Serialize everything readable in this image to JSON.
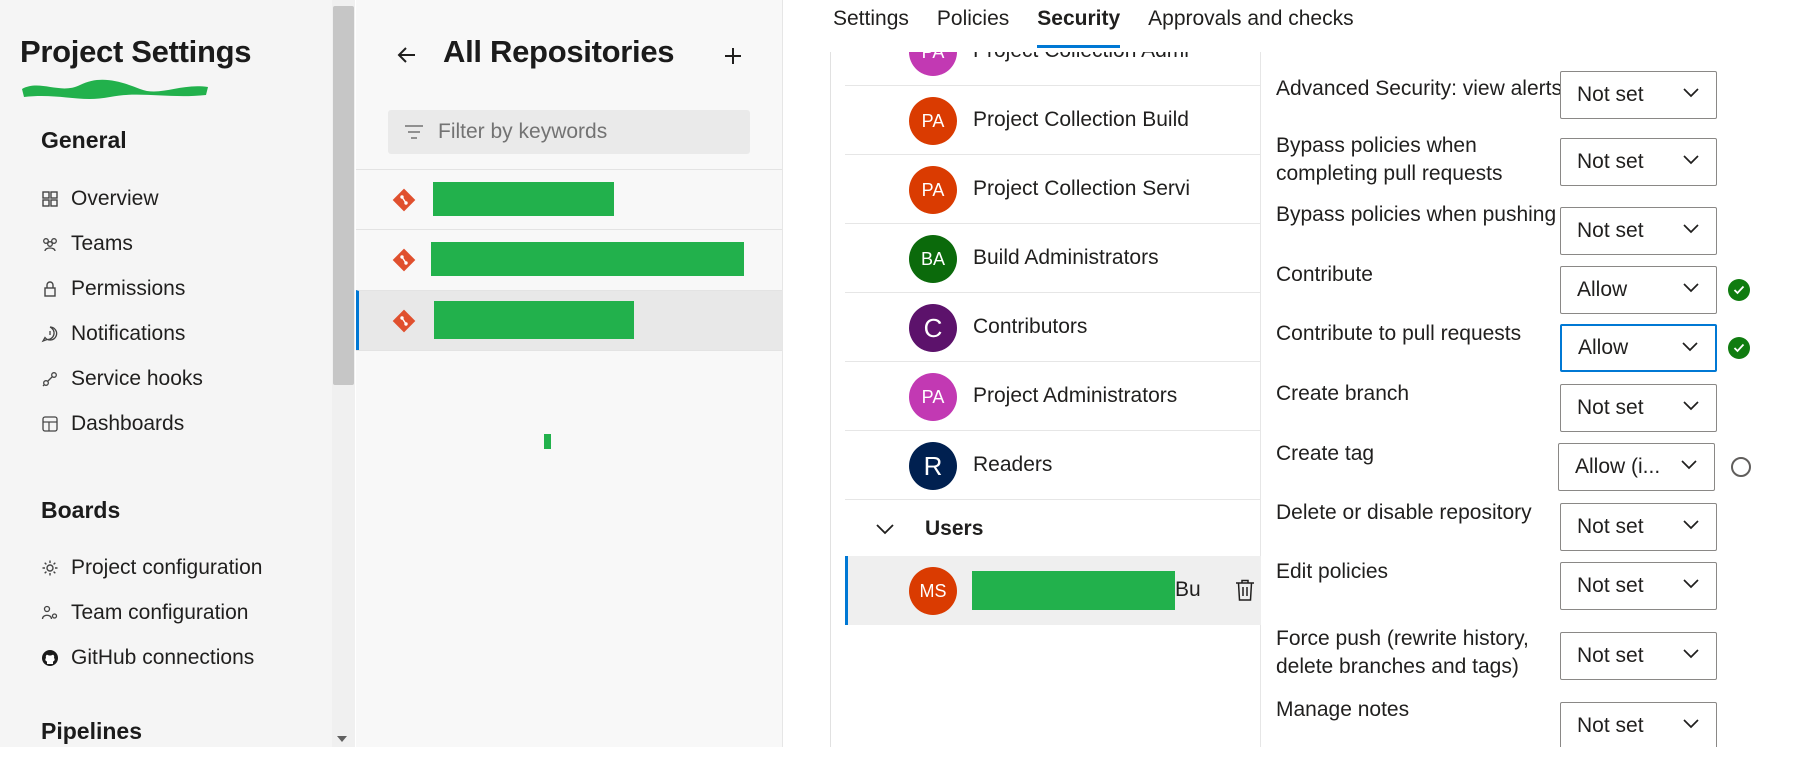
{
  "sidebar": {
    "title": "Project Settings",
    "sections": [
      {
        "heading": "General",
        "items": [
          {
            "label": "Overview",
            "icon": "overview-icon"
          },
          {
            "label": "Teams",
            "icon": "teams-icon"
          },
          {
            "label": "Permissions",
            "icon": "lock-icon"
          },
          {
            "label": "Notifications",
            "icon": "notification-icon"
          },
          {
            "label": "Service hooks",
            "icon": "service-hooks-icon"
          },
          {
            "label": "Dashboards",
            "icon": "dashboards-icon"
          }
        ]
      },
      {
        "heading": "Boards",
        "items": [
          {
            "label": "Project configuration",
            "icon": "project-config-icon"
          },
          {
            "label": "Team configuration",
            "icon": "team-config-icon"
          },
          {
            "label": "GitHub connections",
            "icon": "github-icon"
          }
        ]
      },
      {
        "heading": "Pipelines",
        "items": []
      }
    ]
  },
  "repositories": {
    "title": "All Repositories",
    "filter_placeholder": "Filter by keywords",
    "selected_index": 2
  },
  "tabs": [
    {
      "label": "Settings",
      "active": false
    },
    {
      "label": "Policies",
      "active": false
    },
    {
      "label": "Security",
      "active": true
    },
    {
      "label": "Approvals and checks",
      "active": false
    }
  ],
  "identities": {
    "groups": [
      {
        "initials": "PA",
        "name": "Project Collection Admi",
        "color": "#c239b3"
      },
      {
        "initials": "PA",
        "name": "Project Collection Build",
        "color": "#da3b01"
      },
      {
        "initials": "PA",
        "name": "Project Collection Servi",
        "color": "#da3b01"
      },
      {
        "initials": "BA",
        "name": "Build Administrators",
        "color": "#0b6a0b"
      },
      {
        "initials": "C",
        "name": "Contributors",
        "color": "#5c126b"
      },
      {
        "initials": "PA",
        "name": "Project Administrators",
        "color": "#c239b3"
      },
      {
        "initials": "R",
        "name": "Readers",
        "color": "#002050"
      }
    ],
    "users_group_label": "Users",
    "selected_user": {
      "initials": "MS",
      "suffix": "Bu",
      "color": "#da3b01"
    }
  },
  "permissions": [
    {
      "label": "Advanced Security: view alerts",
      "value": "Not set"
    },
    {
      "label": "Bypass policies when completing pull requests",
      "value": "Not set"
    },
    {
      "label": "Bypass policies when pushing",
      "value": "Not set"
    },
    {
      "label": "Contribute",
      "value": "Allow",
      "status": "check"
    },
    {
      "label": "Contribute to pull requests",
      "value": "Allow",
      "status": "check",
      "focused": true
    },
    {
      "label": "Create branch",
      "value": "Not set"
    },
    {
      "label": "Create tag",
      "value": "Allow (i...",
      "status": "info"
    },
    {
      "label": "Delete or disable repository",
      "value": "Not set"
    },
    {
      "label": "Edit policies",
      "value": "Not set"
    },
    {
      "label": "Force push (rewrite history, delete branches and tags)",
      "value": "Not set"
    },
    {
      "label": "Manage notes",
      "value": "Not set"
    }
  ],
  "colors": {
    "accent": "#0078d4",
    "allow_check": "#107c10",
    "redaction": "#22b14c",
    "git_repo_icon": "#e0502e"
  }
}
